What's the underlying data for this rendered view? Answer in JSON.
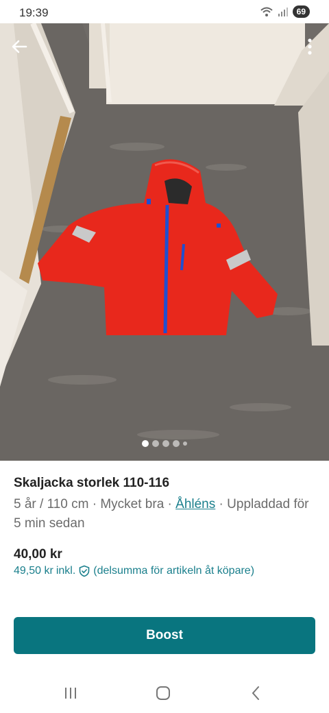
{
  "status_bar": {
    "time": "19:39",
    "battery": "69",
    "icons": [
      "wifi-icon",
      "signal-icon",
      "battery-icon"
    ]
  },
  "photo": {
    "back_icon": "arrow-left-icon",
    "more_icon": "more-vertical-icon",
    "page_indicator": {
      "total": 5,
      "active": 1
    }
  },
  "listing": {
    "title": "Skaljacka storlek 110-116",
    "meta_prefix": "5 år / 110 cm · Mycket bra · ",
    "brand": "Åhléns",
    "meta_suffix": " · Uppladdad för 5 min sedan",
    "price": "40,00 kr",
    "price_incl_value": "49,50 kr",
    "price_incl_label": "inkl.",
    "price_incl_icon": "shield-check-icon",
    "price_incl_note": "(delsumma för artikeln åt köpare)"
  },
  "actions": {
    "boost_label": "Boost"
  },
  "nav": {
    "recents_icon": "recents-icon",
    "home_icon": "home-icon",
    "back_icon": "back-chevron-icon"
  },
  "colors": {
    "accent": "#09757f",
    "link": "#1a7f8c",
    "jacket": "#e8281c"
  }
}
